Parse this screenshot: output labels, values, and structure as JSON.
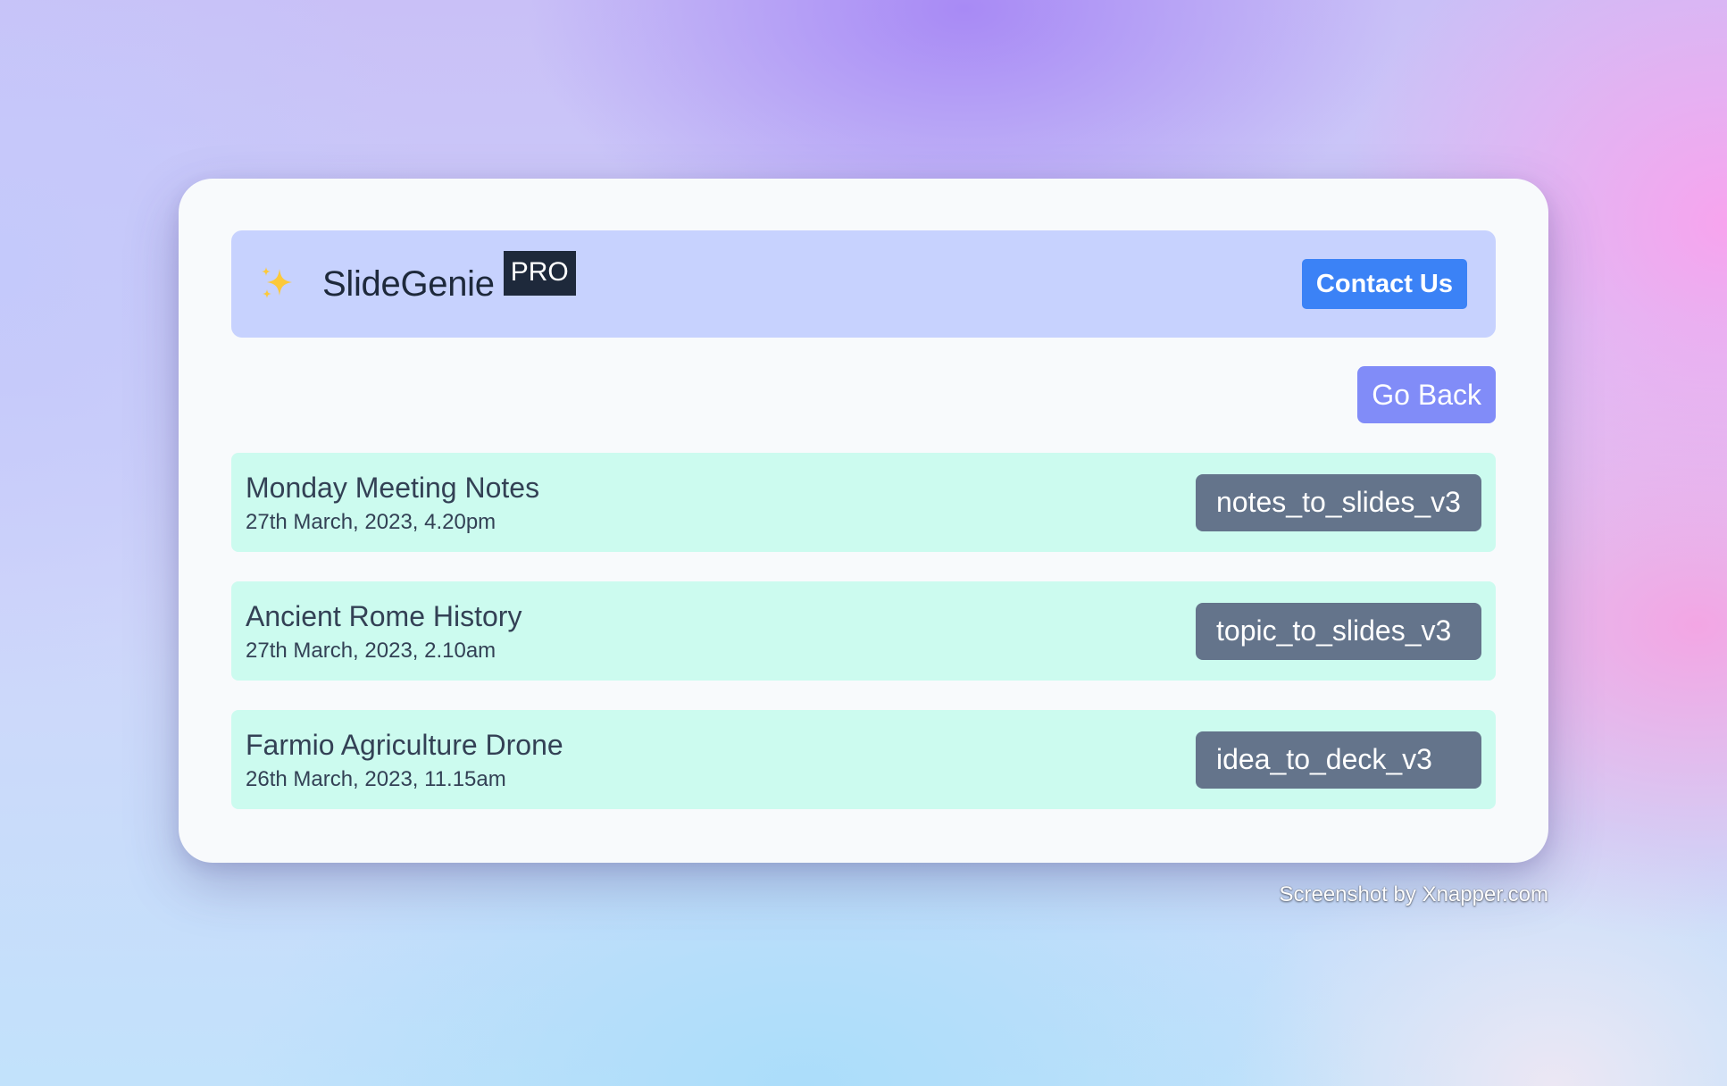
{
  "header": {
    "brand_name": "SlideGenie",
    "badge": "PRO",
    "contact_label": "Contact Us",
    "logo_icon": "sparkles-icon"
  },
  "toolbar": {
    "back_label": "Go Back"
  },
  "items": [
    {
      "title": "Monday Meeting Notes",
      "date": "27th March, 2023, 4.20pm",
      "template": "notes_to_slides_v3"
    },
    {
      "title": "Ancient Rome History",
      "date": "27th March, 2023, 2.10am",
      "template": "topic_to_slides_v3"
    },
    {
      "title": "Farmio Agriculture Drone",
      "date": "26th March, 2023, 11.15am",
      "template": "idea_to_deck_v3"
    }
  ],
  "watermark": "Screenshot by Xnapper.com",
  "colors": {
    "header_bg": "#c7d2fe",
    "contact_button": "#3b82f6",
    "back_button": "#818cf8",
    "row_bg": "#ccfbef",
    "tag_bg": "#64748b",
    "badge_bg": "#1e293b"
  }
}
